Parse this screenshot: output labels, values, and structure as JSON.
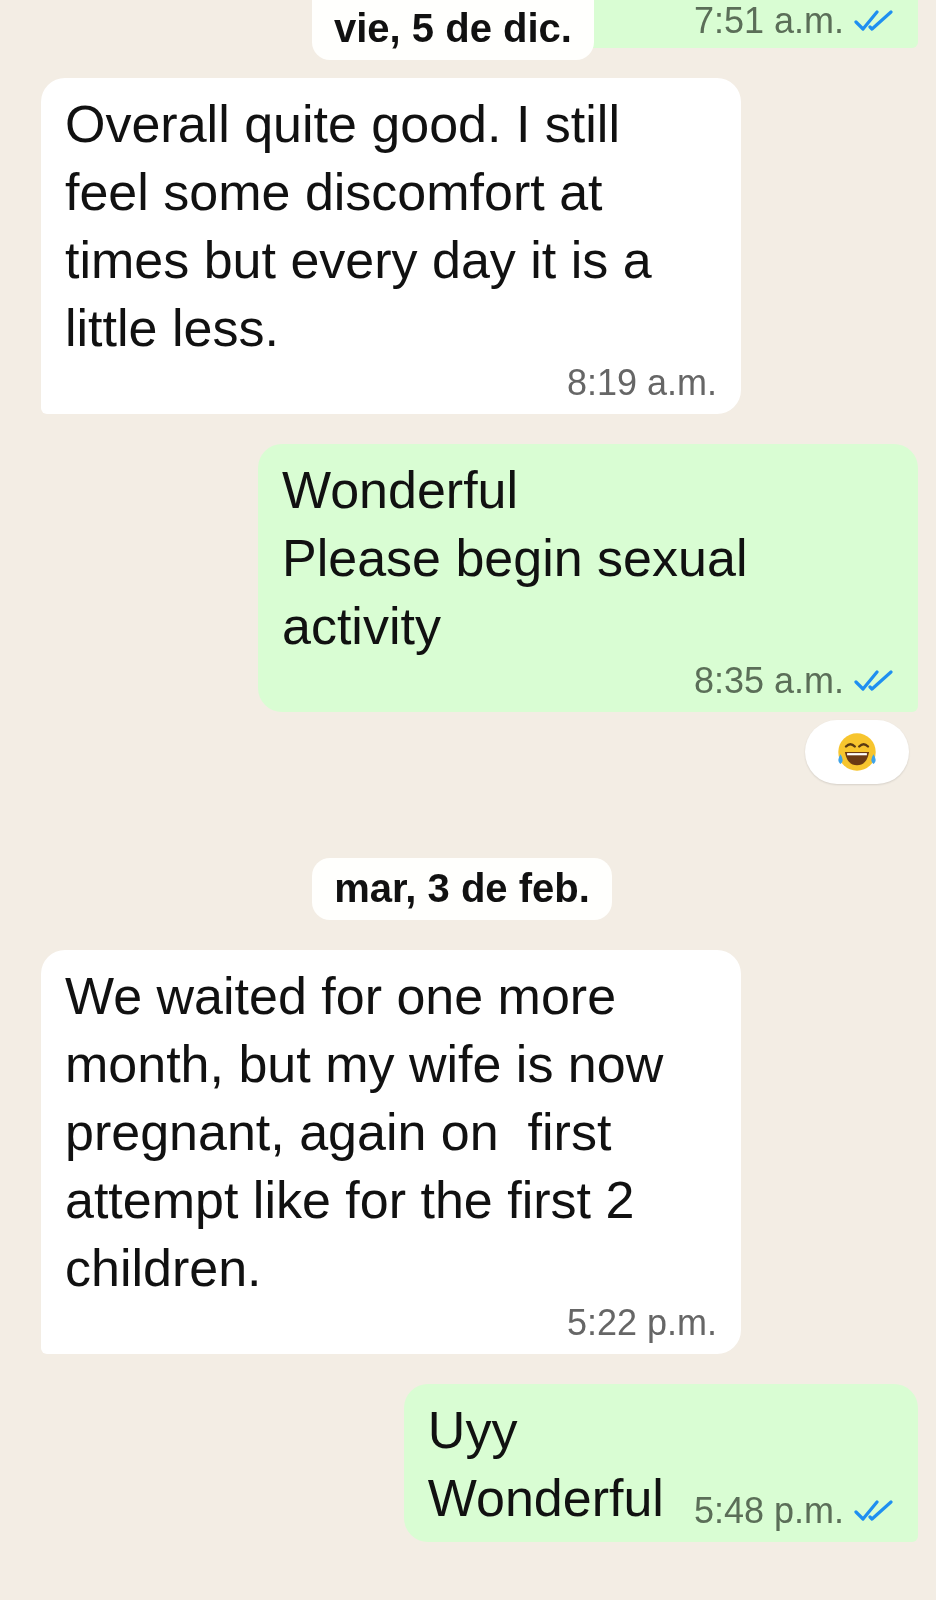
{
  "sticky_date": "vie, 5 de dic.",
  "items": [
    {
      "kind": "message",
      "outgoing": true,
      "cut_top": true,
      "time": "7:51 a.m.",
      "read": true
    },
    {
      "kind": "message",
      "outgoing": false,
      "text": "Overall quite good. I still feel some discomfort at times but every day it is a little less.",
      "time": "8:19 a.m."
    },
    {
      "kind": "message",
      "outgoing": true,
      "text": "Wonderful\nPlease begin sexual activity",
      "time": "8:35 a.m.",
      "read": true,
      "reaction": true
    },
    {
      "kind": "date",
      "text": "mar, 3 de feb."
    },
    {
      "kind": "message",
      "outgoing": false,
      "text": "We waited for one more month, but my wife is now pregnant, again on  first attempt like for the first 2 children.",
      "time": "5:22 p.m."
    },
    {
      "kind": "message",
      "outgoing": true,
      "text": "Uyy\nWonderful",
      "time": "5:48 p.m.",
      "read": true
    }
  ]
}
